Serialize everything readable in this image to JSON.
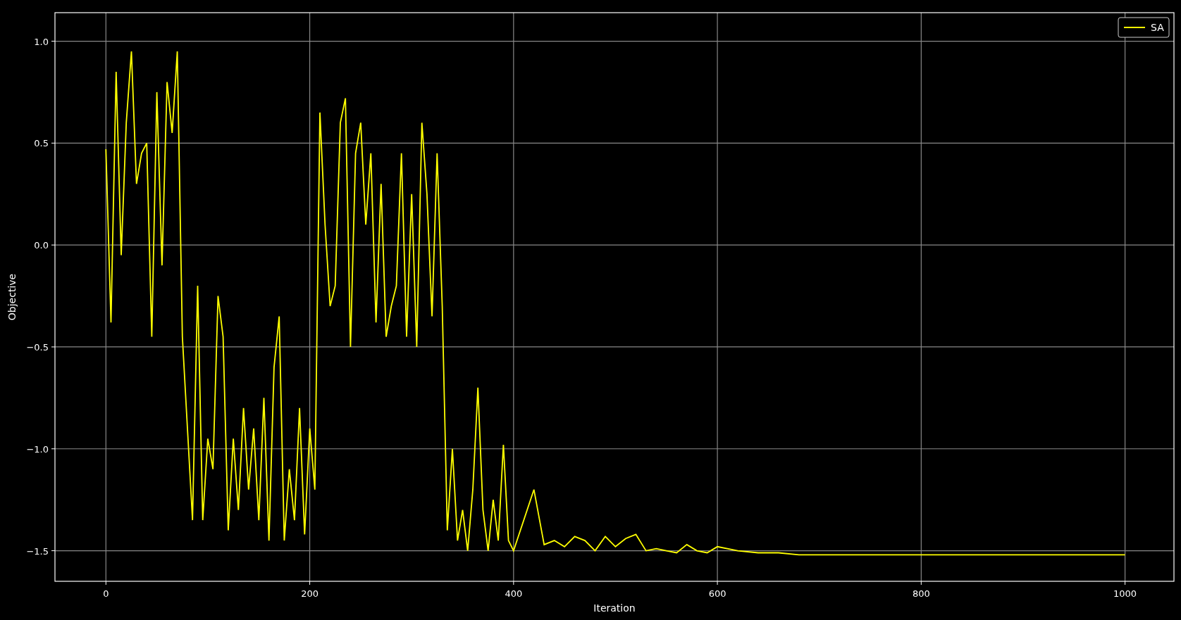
{
  "chart_data": {
    "type": "line",
    "grid": true,
    "xlabel": "Iteration",
    "ylabel": "Objective",
    "xlim": [
      -50,
      1048
    ],
    "ylim": [
      -1.65,
      1.14
    ],
    "xticks": [
      0,
      200,
      400,
      600,
      800,
      1000
    ],
    "yticks": [
      {
        "value": -1.5,
        "label": "−1.5"
      },
      {
        "value": -1.0,
        "label": "−1.0"
      },
      {
        "value": -0.5,
        "label": "−0.5"
      },
      {
        "value": 0,
        "label": "0.0"
      },
      {
        "value": 0.5,
        "label": "0.5"
      },
      {
        "value": 1.0,
        "label": "1.0"
      }
    ],
    "x": [
      0,
      5,
      10,
      15,
      20,
      25,
      30,
      35,
      40,
      45,
      50,
      55,
      60,
      65,
      70,
      75,
      80,
      85,
      90,
      95,
      100,
      105,
      110,
      115,
      120,
      125,
      130,
      135,
      140,
      145,
      150,
      155,
      160,
      165,
      170,
      175,
      180,
      185,
      190,
      195,
      200,
      205,
      210,
      215,
      220,
      225,
      230,
      235,
      240,
      245,
      250,
      255,
      260,
      265,
      270,
      275,
      280,
      285,
      290,
      295,
      300,
      305,
      310,
      315,
      320,
      325,
      330,
      335,
      340,
      345,
      350,
      355,
      360,
      365,
      370,
      375,
      380,
      385,
      390,
      395,
      400,
      410,
      420,
      430,
      440,
      450,
      460,
      470,
      480,
      490,
      500,
      510,
      520,
      530,
      540,
      550,
      560,
      570,
      580,
      590,
      600,
      620,
      640,
      660,
      680,
      700,
      750,
      800,
      850,
      900,
      950,
      1000
    ],
    "series": [
      {
        "name": "SA",
        "color": "#ffff00",
        "values": [
          0.47,
          -0.38,
          0.85,
          -0.05,
          0.6,
          0.95,
          0.3,
          0.45,
          0.5,
          -0.45,
          0.75,
          -0.1,
          0.8,
          0.55,
          0.95,
          -0.45,
          -0.9,
          -1.35,
          -0.2,
          -1.35,
          -0.95,
          -1.1,
          -0.25,
          -0.45,
          -1.4,
          -0.95,
          -1.3,
          -0.8,
          -1.2,
          -0.9,
          -1.35,
          -0.75,
          -1.45,
          -0.6,
          -0.35,
          -1.45,
          -1.1,
          -1.35,
          -0.8,
          -1.42,
          -0.9,
          -1.2,
          0.65,
          0.1,
          -0.3,
          -0.2,
          0.6,
          0.72,
          -0.5,
          0.45,
          0.6,
          0.1,
          0.45,
          -0.38,
          0.3,
          -0.45,
          -0.3,
          -0.2,
          0.45,
          -0.45,
          0.25,
          -0.5,
          0.6,
          0.25,
          -0.35,
          0.45,
          -0.3,
          -1.4,
          -1.0,
          -1.45,
          -1.3,
          -1.5,
          -1.2,
          -0.7,
          -1.3,
          -1.5,
          -1.25,
          -1.45,
          -0.98,
          -1.45,
          -1.5,
          -1.35,
          -1.2,
          -1.47,
          -1.45,
          -1.48,
          -1.43,
          -1.45,
          -1.5,
          -1.43,
          -1.48,
          -1.44,
          -1.42,
          -1.5,
          -1.49,
          -1.5,
          -1.51,
          -1.47,
          -1.5,
          -1.51,
          -1.48,
          -1.5,
          -1.51,
          -1.51,
          -1.52,
          -1.52,
          -1.52,
          -1.52,
          -1.52,
          -1.52,
          -1.52,
          -1.52
        ]
      }
    ]
  }
}
